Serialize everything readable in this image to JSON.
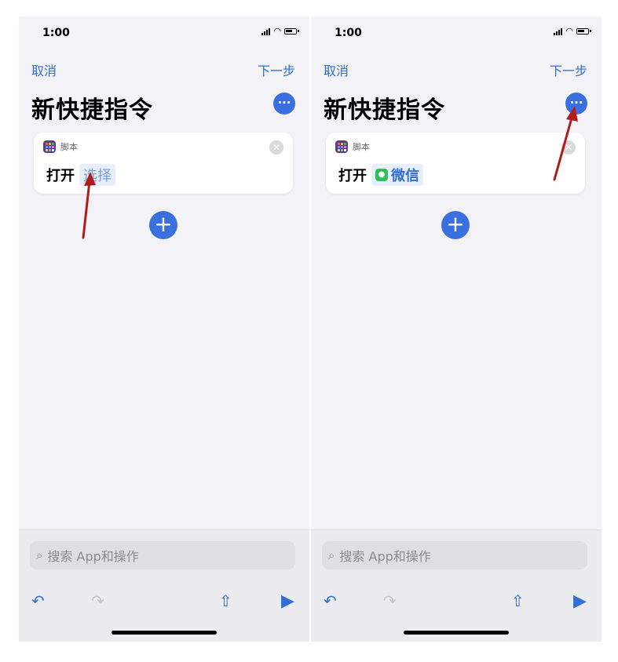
{
  "panels": [
    {
      "status": {
        "time": "1:00"
      },
      "nav": {
        "cancel": "取消",
        "next": "下一步"
      },
      "title": "新快捷指令",
      "more_glyph": "···",
      "card": {
        "category": "脚本",
        "verb": "打开",
        "target": "选择",
        "target_state": "placeholder"
      },
      "add_glyph": "+",
      "search": {
        "placeholder": "搜索 App和操作"
      }
    },
    {
      "status": {
        "time": "1:00"
      },
      "nav": {
        "cancel": "取消",
        "next": "下一步"
      },
      "title": "新快捷指令",
      "more_glyph": "···",
      "card": {
        "category": "脚本",
        "verb": "打开",
        "target": "微信",
        "target_state": "selected-app"
      },
      "add_glyph": "+",
      "search": {
        "placeholder": "搜索 App和操作"
      }
    }
  ],
  "icons": {
    "script": "script-grid-icon",
    "wechat": "wechat-icon",
    "search": "magnifier",
    "undo": "undo-arrow",
    "redo": "redo-arrow",
    "share": "share-box",
    "run": "play-triangle"
  },
  "colors": {
    "accent": "#2f6fd6",
    "button_fill": "#3a6fe0",
    "annotation_arrow": "#b01c1c",
    "background": "#f2f2f7"
  }
}
